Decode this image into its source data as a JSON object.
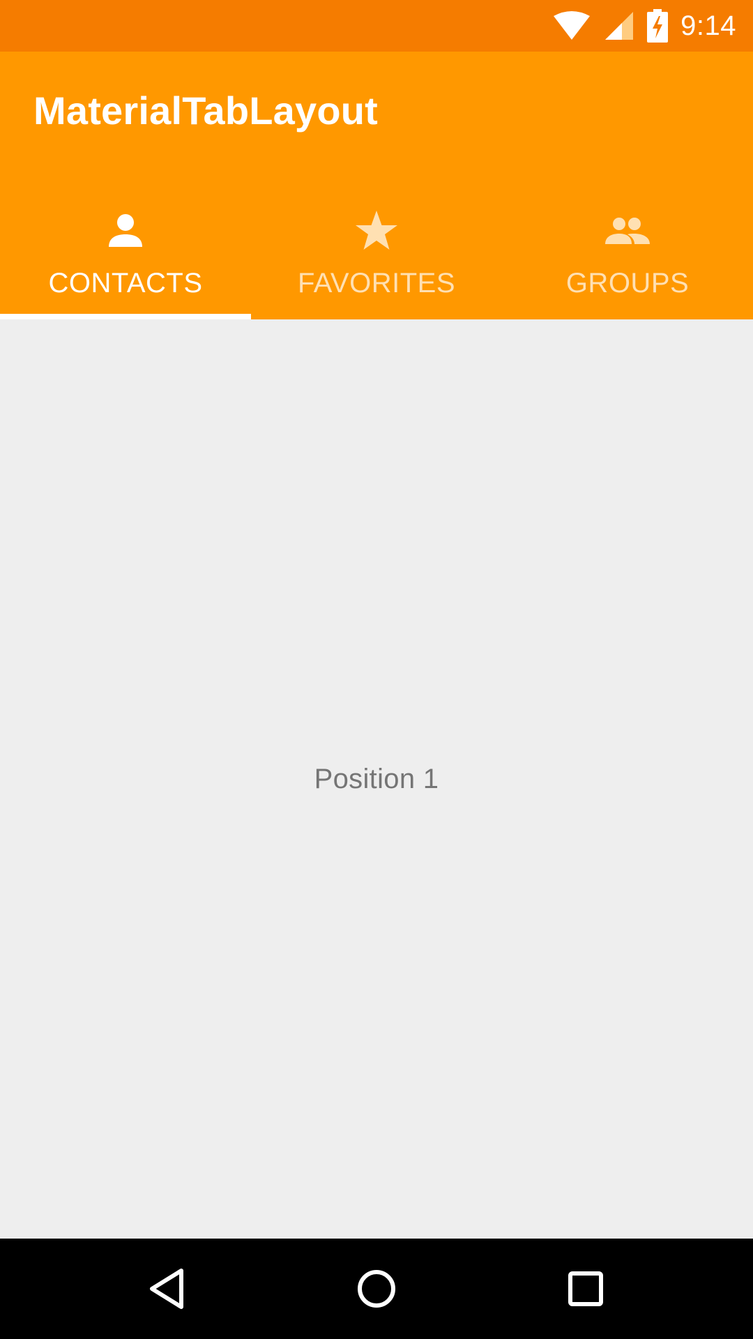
{
  "status_bar": {
    "time": "9:14",
    "icons": [
      "wifi-icon",
      "cell-signal-icon",
      "battery-charging-icon"
    ]
  },
  "app_bar": {
    "title": "MaterialTabLayout",
    "color": "#ff9800",
    "status_color": "#f57c00"
  },
  "tabs": [
    {
      "label": "CONTACTS",
      "icon": "person-icon",
      "active": true
    },
    {
      "label": "FAVORITES",
      "icon": "star-icon",
      "active": false
    },
    {
      "label": "GROUPS",
      "icon": "group-icon",
      "active": false
    }
  ],
  "content": {
    "text": "Position 1"
  },
  "nav_bar": {
    "buttons": [
      "back-icon",
      "home-icon",
      "recents-icon"
    ]
  }
}
